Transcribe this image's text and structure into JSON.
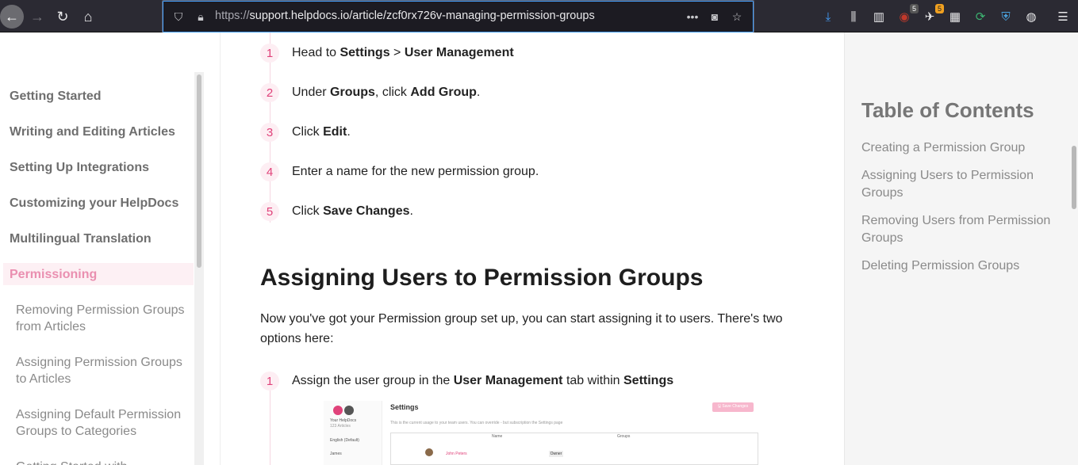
{
  "browser": {
    "url_prefix": "https://",
    "url_rest": "support.helpdocs.io/article/zcf0rx726v-managing-permission-groups",
    "extension_badges": [
      "5",
      "5"
    ]
  },
  "sidebar": {
    "items": [
      {
        "label": "Getting Started"
      },
      {
        "label": "Writing and Editing Articles"
      },
      {
        "label": "Setting Up Integrations"
      },
      {
        "label": "Customizing your HelpDocs"
      },
      {
        "label": "Multilingual Translation"
      },
      {
        "label": "Permissioning"
      }
    ],
    "sub_items": [
      {
        "label": "Removing Permission Groups from Articles"
      },
      {
        "label": "Assigning Permission Groups to Articles"
      },
      {
        "label": "Assigning Default Permission Groups to Categories"
      },
      {
        "label": "Getting Started with"
      }
    ]
  },
  "main": {
    "steps_top": [
      {
        "num": "1",
        "pre": "Head to ",
        "b1": "Settings",
        "mid": " > ",
        "b2": "User Management",
        "post": ""
      },
      {
        "num": "2",
        "pre": "Under ",
        "b1": "Groups",
        "mid": ", click ",
        "b2": "Add Group",
        "post": "."
      },
      {
        "num": "3",
        "pre": "Click ",
        "b1": "Edit",
        "mid": ".",
        "b2": "",
        "post": ""
      },
      {
        "num": "4",
        "pre": "Enter a name for the new permission group.",
        "b1": "",
        "mid": "",
        "b2": "",
        "post": ""
      },
      {
        "num": "5",
        "pre": "Click ",
        "b1": "Save Changes",
        "mid": ".",
        "b2": "",
        "post": ""
      }
    ],
    "heading": "Assigning Users to Permission Groups",
    "paragraph": "Now you've got your Permission group set up, you can start assigning it to users. There's two options here:",
    "step_bottom": {
      "num": "1",
      "pre": "Assign the user group in the ",
      "b1": "User Management",
      "mid": " tab within ",
      "b2": "Settings",
      "post": ""
    },
    "embedded": {
      "title": "Settings",
      "save_btn": "🖫 Save Changes",
      "subtitle": "This is the current usage to your team users. You can override - but subscription the Settings page",
      "col_name": "Name",
      "col_groups": "Groups",
      "user_name": "John Peters",
      "role": "Owner",
      "side_brand": "Your HelpDocs",
      "side_sub": "123 Articles",
      "side_lang": "English (Default)",
      "side_user": "James"
    }
  },
  "toc": {
    "title": "Table of Contents",
    "links": [
      {
        "label": "Creating a Permission Group"
      },
      {
        "label": "Assigning Users to Permission Groups"
      },
      {
        "label": "Removing Users from Permission Groups"
      },
      {
        "label": "Deleting Permission Groups"
      }
    ]
  }
}
